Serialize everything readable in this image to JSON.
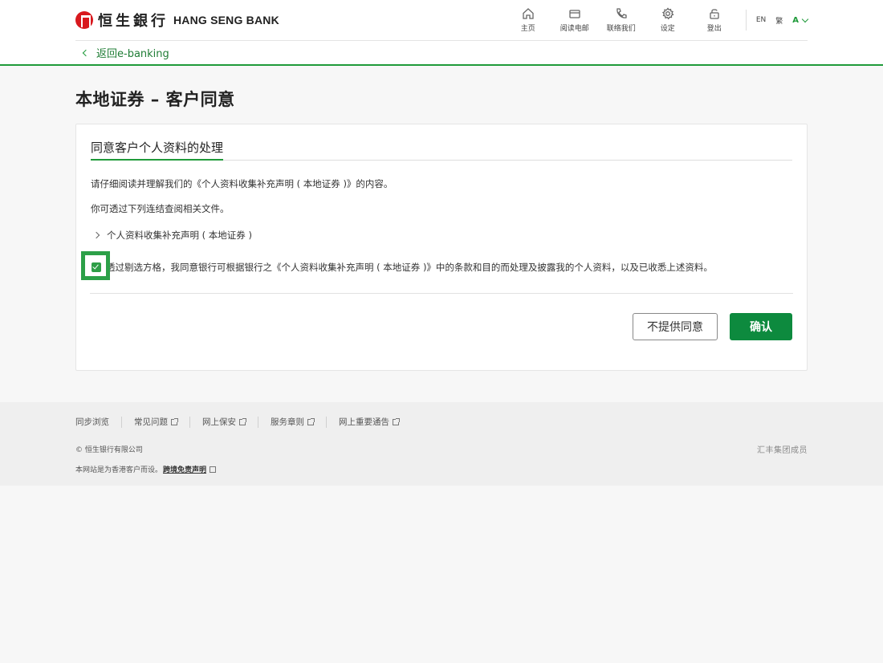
{
  "header": {
    "brand_cn": "恒生銀行",
    "brand_en": "HANG SENG BANK",
    "nav": [
      {
        "label": "主页",
        "icon": "home-icon"
      },
      {
        "label": "阅读电邮",
        "icon": "mail-icon"
      },
      {
        "label": "联络我们",
        "icon": "phone-icon"
      },
      {
        "label": "设定",
        "icon": "gear-icon"
      },
      {
        "label": "登出",
        "icon": "unlock-icon"
      }
    ],
    "lang_en": "EN",
    "lang_tc": "繁",
    "font_size": "A"
  },
  "back_link": "返回e-banking",
  "page_title": "本地证券 – 客户同意",
  "card": {
    "section_title": "同意客户个人资料的处理",
    "para1": "请仔细阅读并理解我们的《个人资料收集补充声明 ( 本地证券 )》的内容。",
    "para2": "你可透过下列连结查阅相关文件。",
    "doc_link": "个人资料收集补充声明 ( 本地证券 )",
    "consent_text": "透过剔选方格，我同意银行可根据银行之《个人资料收集补充声明 ( 本地证券 )》中的条款和目的而处理及披露我的个人资料，以及已收悉上述资料。",
    "consent_checked": true,
    "decline_label": "不提供同意",
    "confirm_label": "确认"
  },
  "footer": {
    "links": [
      "同步浏览",
      "常见问题",
      "网上保安",
      "服务章则",
      "网上重要通告"
    ],
    "copyright": "© 恒生银行有限公司",
    "notice_text": "本网站是为香港客户而设。",
    "notice_link": "跨境免责声明",
    "member": "汇丰集团成员"
  },
  "colors": {
    "accent": "#1f9a3a",
    "primary_button": "#0d8a3e",
    "logo_red": "#d8191e",
    "highlight": "#2ca048"
  }
}
